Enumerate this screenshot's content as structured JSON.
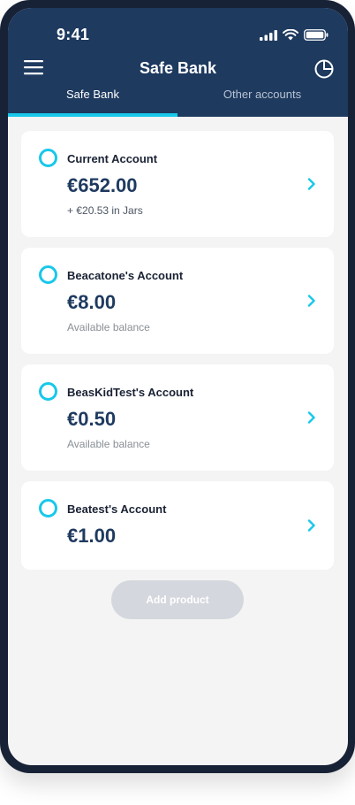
{
  "status_bar": {
    "time": "9:41"
  },
  "header": {
    "title": "Safe Bank"
  },
  "tabs": [
    {
      "label": "Safe Bank",
      "active": true
    },
    {
      "label": "Other accounts",
      "active": false
    }
  ],
  "accounts": [
    {
      "name": "Current Account",
      "amount": "€652.00",
      "subtitle": "+ €20.53 in Jars"
    },
    {
      "name": "Beacatone's Account",
      "amount": "€8.00",
      "subtitle": "Available balance"
    },
    {
      "name": "BeasKidTest's Account",
      "amount": "€0.50",
      "subtitle": "Available balance"
    },
    {
      "name": "Beatest's Account",
      "amount": "€1.00",
      "subtitle": ""
    }
  ],
  "actions": {
    "add_product": "Add product"
  },
  "colors": {
    "header_bg": "#1e3a5f",
    "accent": "#18c8ea",
    "button_disabled": "#d4d7dd"
  }
}
